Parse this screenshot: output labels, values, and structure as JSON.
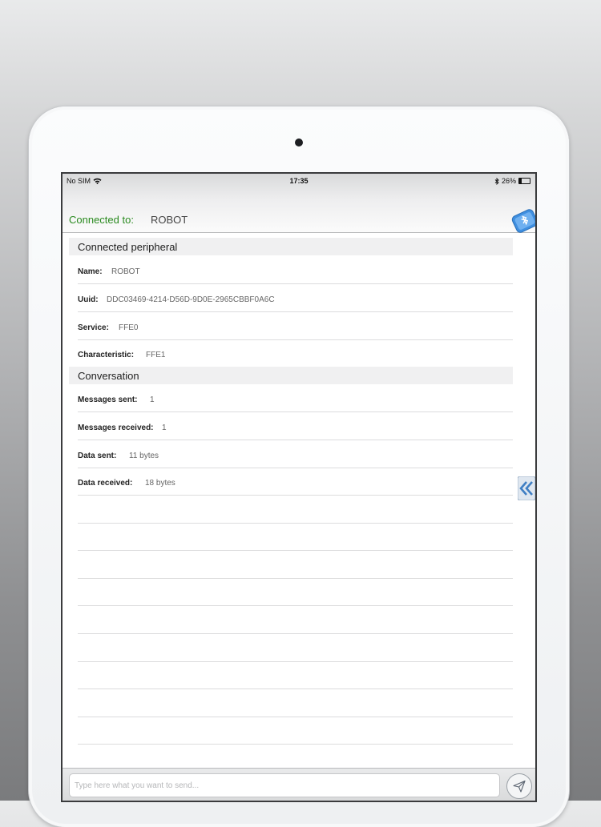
{
  "status_bar": {
    "carrier": "No SIM",
    "time": "17:35",
    "battery": "26%",
    "battery_level": 0.26
  },
  "header": {
    "connected_label": "Connected to:",
    "device_name": "ROBOT"
  },
  "peripheral": {
    "title": "Connected peripheral",
    "rows": [
      {
        "key": "Name:",
        "value": "ROBOT"
      },
      {
        "key": "Uuid:",
        "value": "DDC03469-4214-D56D-9D0E-2965CBBF0A6C"
      },
      {
        "key": "Service:",
        "value": "FFE0"
      },
      {
        "key": "Characteristic:",
        "value": "FFE1"
      }
    ]
  },
  "conversation": {
    "title": "Conversation",
    "rows": [
      {
        "key": "Messages sent:",
        "value": "1"
      },
      {
        "key": "Messages received:",
        "value": "1"
      },
      {
        "key": "Data sent:",
        "value": "11 bytes"
      },
      {
        "key": "Data received:",
        "value": "18 bytes"
      }
    ]
  },
  "composer": {
    "placeholder": "Type here what you want to send..."
  },
  "icons": {
    "bluetooth": "bluetooth-icon",
    "wifi": "wifi-icon",
    "battery": "battery-icon",
    "side_arrow": "double-chevron-left-icon",
    "send": "paper-plane-icon"
  },
  "colors": {
    "connected_label": "#2a8a1f",
    "badge_blue": "#3f8fe0"
  }
}
